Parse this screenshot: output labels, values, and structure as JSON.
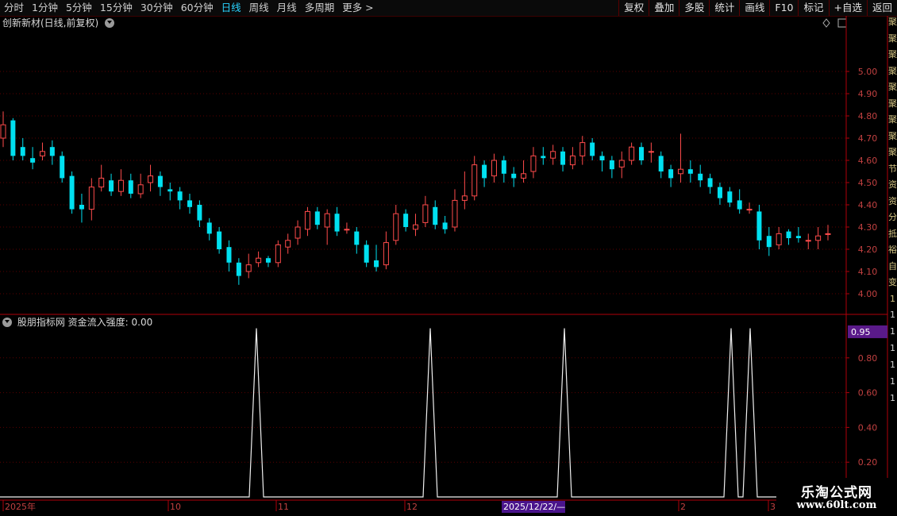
{
  "toolbar": {
    "tabs": [
      {
        "label": "分时",
        "active": false
      },
      {
        "label": "1分钟",
        "active": false
      },
      {
        "label": "5分钟",
        "active": false
      },
      {
        "label": "15分钟",
        "active": false
      },
      {
        "label": "30分钟",
        "active": false
      },
      {
        "label": "60分钟",
        "active": false
      },
      {
        "label": "日线",
        "active": true
      },
      {
        "label": "周线",
        "active": false
      },
      {
        "label": "月线",
        "active": false
      },
      {
        "label": "多周期",
        "active": false
      },
      {
        "label": "更多 >",
        "active": false
      }
    ],
    "right_buttons": [
      "复权",
      "叠加",
      "多股",
      "统计",
      "画线",
      "F10",
      "标记",
      "+自选",
      "返回"
    ]
  },
  "main_chart": {
    "title": "创新新材(日线,前复权)",
    "y_ticks": [
      "5.00",
      "4.90",
      "4.80",
      "4.70",
      "4.60",
      "4.50",
      "4.40",
      "4.30",
      "4.20",
      "4.10",
      "4.00"
    ],
    "colors": {
      "up": "#ff4b4b",
      "down": "#00e0f0",
      "axis": "#b0000a",
      "tick_text": "#c04040"
    }
  },
  "sub_chart": {
    "title": "股朋指标网 资金流入强度: 0.00",
    "current_value_badge": "0.95",
    "y_ticks": [
      "0.80",
      "0.60",
      "0.40",
      "0.20"
    ]
  },
  "date_axis": {
    "labels": [
      "2025年",
      "10",
      "11",
      "12",
      "2025/12/22/—",
      "2",
      "3"
    ],
    "cursor_label": "2025/12/22/—"
  },
  "right_strip_chars": "聚聚聚聚聚聚聚聚聚节资资分抵裕自变1111111",
  "logo": {
    "line1": "乐淘公式网",
    "line2": "www.60lt.com"
  },
  "chart_data": [
    {
      "type": "candlestick",
      "title": "创新新材(日线,前复权)",
      "ylim": [
        3.96,
        5.15
      ],
      "candles": [
        [
          4.7,
          4.76,
          4.66,
          4.82
        ],
        [
          4.78,
          4.62,
          4.6,
          4.79
        ],
        [
          4.66,
          4.62,
          4.6,
          4.7
        ],
        [
          4.61,
          4.59,
          4.56,
          4.66
        ],
        [
          4.62,
          4.64,
          4.6,
          4.68
        ],
        [
          4.66,
          4.62,
          4.58,
          4.69
        ],
        [
          4.62,
          4.52,
          4.5,
          4.64
        ],
        [
          4.53,
          4.38,
          4.36,
          4.55
        ],
        [
          4.4,
          4.38,
          4.32,
          4.45
        ],
        [
          4.38,
          4.48,
          4.33,
          4.52
        ],
        [
          4.48,
          4.52,
          4.46,
          4.58
        ],
        [
          4.51,
          4.46,
          4.44,
          4.54
        ],
        [
          4.46,
          4.51,
          4.44,
          4.56
        ],
        [
          4.51,
          4.45,
          4.43,
          4.54
        ],
        [
          4.45,
          4.49,
          4.43,
          4.54
        ],
        [
          4.5,
          4.53,
          4.46,
          4.58
        ],
        [
          4.53,
          4.48,
          4.44,
          4.55
        ],
        [
          4.47,
          4.46,
          4.42,
          4.5
        ],
        [
          4.46,
          4.42,
          4.38,
          4.48
        ],
        [
          4.42,
          4.39,
          4.36,
          4.45
        ],
        [
          4.4,
          4.33,
          4.3,
          4.42
        ],
        [
          4.32,
          4.27,
          4.24,
          4.34
        ],
        [
          4.28,
          4.2,
          4.18,
          4.3
        ],
        [
          4.21,
          4.14,
          4.1,
          4.24
        ],
        [
          4.14,
          4.08,
          4.04,
          4.16
        ],
        [
          4.1,
          4.13,
          4.07,
          4.18
        ],
        [
          4.14,
          4.16,
          4.12,
          4.19
        ],
        [
          4.16,
          4.14,
          4.12,
          4.17
        ],
        [
          4.14,
          4.22,
          4.12,
          4.24
        ],
        [
          4.21,
          4.24,
          4.18,
          4.27
        ],
        [
          4.25,
          4.3,
          4.22,
          4.33
        ],
        [
          4.29,
          4.37,
          4.26,
          4.39
        ],
        [
          4.37,
          4.31,
          4.29,
          4.39
        ],
        [
          4.3,
          4.36,
          4.22,
          4.38
        ],
        [
          4.36,
          4.28,
          4.26,
          4.39
        ],
        [
          4.29,
          4.29,
          4.27,
          4.32
        ],
        [
          4.28,
          4.22,
          4.18,
          4.3
        ],
        [
          4.22,
          4.14,
          4.12,
          4.24
        ],
        [
          4.15,
          4.12,
          4.1,
          4.22
        ],
        [
          4.13,
          4.23,
          4.11,
          4.28
        ],
        [
          4.24,
          4.36,
          4.22,
          4.4
        ],
        [
          4.36,
          4.3,
          4.28,
          4.38
        ],
        [
          4.29,
          4.31,
          4.26,
          4.36
        ],
        [
          4.32,
          4.4,
          4.3,
          4.44
        ],
        [
          4.39,
          4.31,
          4.29,
          4.42
        ],
        [
          4.32,
          4.29,
          4.27,
          4.35
        ],
        [
          4.3,
          4.42,
          4.28,
          4.47
        ],
        [
          4.42,
          4.44,
          4.38,
          4.55
        ],
        [
          4.44,
          4.58,
          4.42,
          4.62
        ],
        [
          4.58,
          4.52,
          4.48,
          4.6
        ],
        [
          4.53,
          4.6,
          4.5,
          4.63
        ],
        [
          4.6,
          4.54,
          4.5,
          4.62
        ],
        [
          4.54,
          4.52,
          4.48,
          4.57
        ],
        [
          4.52,
          4.54,
          4.5,
          4.6
        ],
        [
          4.55,
          4.62,
          4.52,
          4.66
        ],
        [
          4.62,
          4.61,
          4.58,
          4.66
        ],
        [
          4.61,
          4.64,
          4.58,
          4.67
        ],
        [
          4.64,
          4.58,
          4.55,
          4.66
        ],
        [
          4.58,
          4.62,
          4.56,
          4.66
        ],
        [
          4.62,
          4.68,
          4.58,
          4.71
        ],
        [
          4.68,
          4.62,
          4.6,
          4.7
        ],
        [
          4.62,
          4.6,
          4.55,
          4.64
        ],
        [
          4.6,
          4.56,
          4.52,
          4.62
        ],
        [
          4.57,
          4.6,
          4.52,
          4.64
        ],
        [
          4.6,
          4.66,
          4.58,
          4.68
        ],
        [
          4.66,
          4.6,
          4.58,
          4.68
        ],
        [
          4.64,
          4.64,
          4.59,
          4.68
        ],
        [
          4.62,
          4.55,
          4.52,
          4.64
        ],
        [
          4.56,
          4.52,
          4.48,
          4.58
        ],
        [
          4.54,
          4.56,
          4.5,
          4.72
        ],
        [
          4.56,
          4.54,
          4.5,
          4.6
        ],
        [
          4.54,
          4.51,
          4.48,
          4.58
        ],
        [
          4.52,
          4.48,
          4.45,
          4.54
        ],
        [
          4.48,
          4.43,
          4.4,
          4.5
        ],
        [
          4.46,
          4.41,
          4.39,
          4.48
        ],
        [
          4.42,
          4.38,
          4.36,
          4.47
        ],
        [
          4.38,
          4.38,
          4.36,
          4.41
        ],
        [
          4.37,
          4.24,
          4.2,
          4.4
        ],
        [
          4.26,
          4.21,
          4.17,
          4.3
        ],
        [
          4.22,
          4.27,
          4.2,
          4.3
        ],
        [
          4.28,
          4.25,
          4.22,
          4.29
        ],
        [
          4.26,
          4.25,
          4.23,
          4.3
        ],
        [
          4.24,
          4.24,
          4.2,
          4.27
        ],
        [
          4.24,
          4.26,
          4.2,
          4.3
        ],
        [
          4.27,
          4.27,
          4.24,
          4.31
        ]
      ],
      "note": "Each candle is [open, close, low, high]."
    },
    {
      "type": "line",
      "title": "资金流入强度",
      "ylim": [
        0,
        1
      ],
      "spike_x": [
        [
          323,
          0.97
        ],
        [
          542,
          0.97
        ],
        [
          711,
          0.97
        ],
        [
          921,
          0.97
        ],
        [
          945,
          0.97
        ]
      ],
      "baseline_value": 0.0
    }
  ]
}
